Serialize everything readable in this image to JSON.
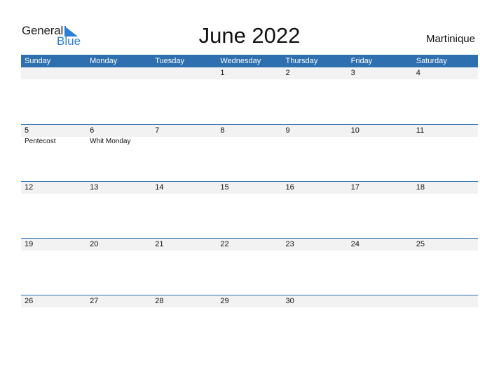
{
  "logo": {
    "text1": "General",
    "text2": "Blue"
  },
  "title": "June 2022",
  "country": "Martinique",
  "colors": {
    "header": "#2e6fb0",
    "accent": "#2a7fd4",
    "daterow": "#f2f2f2"
  },
  "weekdays": [
    "Sunday",
    "Monday",
    "Tuesday",
    "Wednesday",
    "Thursday",
    "Friday",
    "Saturday"
  ],
  "weeks": [
    {
      "dates": [
        "",
        "",
        "",
        "1",
        "2",
        "3",
        "4"
      ],
      "events": [
        "",
        "",
        "",
        "",
        "",
        "",
        ""
      ]
    },
    {
      "dates": [
        "5",
        "6",
        "7",
        "8",
        "9",
        "10",
        "11"
      ],
      "events": [
        "Pentecost",
        "Whit Monday",
        "",
        "",
        "",
        "",
        ""
      ]
    },
    {
      "dates": [
        "12",
        "13",
        "14",
        "15",
        "16",
        "17",
        "18"
      ],
      "events": [
        "",
        "",
        "",
        "",
        "",
        "",
        ""
      ]
    },
    {
      "dates": [
        "19",
        "20",
        "21",
        "22",
        "23",
        "24",
        "25"
      ],
      "events": [
        "",
        "",
        "",
        "",
        "",
        "",
        ""
      ]
    },
    {
      "dates": [
        "26",
        "27",
        "28",
        "29",
        "30",
        "",
        ""
      ],
      "events": [
        "",
        "",
        "",
        "",
        "",
        "",
        ""
      ]
    }
  ]
}
